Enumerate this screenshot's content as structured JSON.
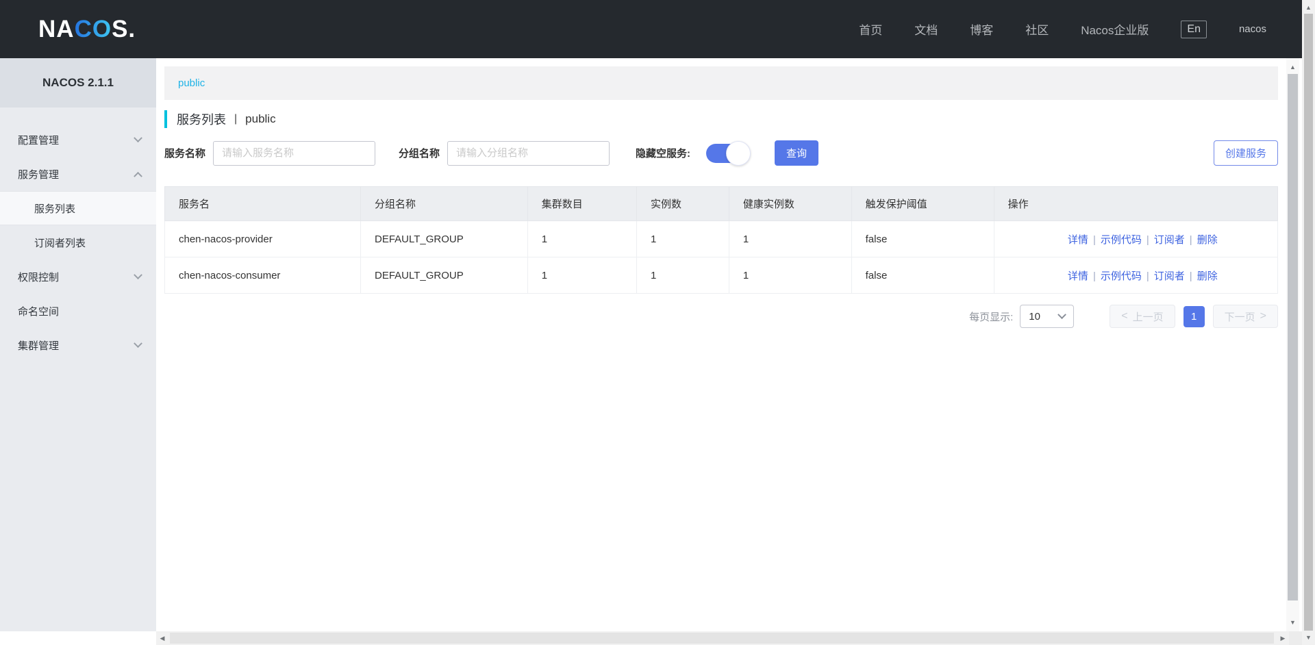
{
  "navbar": {
    "logo_prefix": "NA",
    "logo_mid": "CO",
    "logo_suffix": "S.",
    "links": [
      "首页",
      "文档",
      "博客",
      "社区",
      "Nacos企业版"
    ],
    "lang": "En",
    "username": "nacos"
  },
  "sidebar": {
    "version": "NACOS 2.1.1",
    "items": [
      "配置管理",
      "服务管理",
      "服务列表",
      "订阅者列表",
      "权限控制",
      "命名空间",
      "集群管理"
    ]
  },
  "breadcrumb": {
    "namespace": "public"
  },
  "page": {
    "title": "服务列表",
    "sep": "|",
    "namespace": "public"
  },
  "filters": {
    "service_name_label": "服务名称",
    "service_name_placeholder": "请输入服务名称",
    "group_name_label": "分组名称",
    "group_name_placeholder": "请输入分组名称",
    "hide_empty_label": "隐藏空服务:",
    "search_button": "查询",
    "create_button": "创建服务"
  },
  "table": {
    "headers": [
      "服务名",
      "分组名称",
      "集群数目",
      "实例数",
      "健康实例数",
      "触发保护阈值",
      "操作"
    ],
    "rows": [
      {
        "service": "chen-nacos-provider",
        "group": "DEFAULT_GROUP",
        "clusters": "1",
        "instances": "1",
        "healthy": "1",
        "protect": "false"
      },
      {
        "service": "chen-nacos-consumer",
        "group": "DEFAULT_GROUP",
        "clusters": "1",
        "instances": "1",
        "healthy": "1",
        "protect": "false"
      }
    ],
    "actions": [
      "详情",
      "示例代码",
      "订阅者",
      "删除"
    ],
    "action_sep": "|"
  },
  "pagination": {
    "page_size_label": "每页显示:",
    "page_size": "10",
    "prev": "上一页",
    "current": "1",
    "next": "下一页"
  },
  "icons": {
    "chevron_left": "<",
    "chevron_right": ">",
    "tri_up": "▲",
    "tri_down": "▼",
    "tri_left": "◀",
    "tri_right": "▶"
  },
  "colors": {
    "primary": "#5577e8",
    "cyan_accent": "#00c1de",
    "breadcrumb_link": "#1fb3e6",
    "navbar_bg": "#25292e",
    "sidebar_bg": "#e9ebef"
  }
}
